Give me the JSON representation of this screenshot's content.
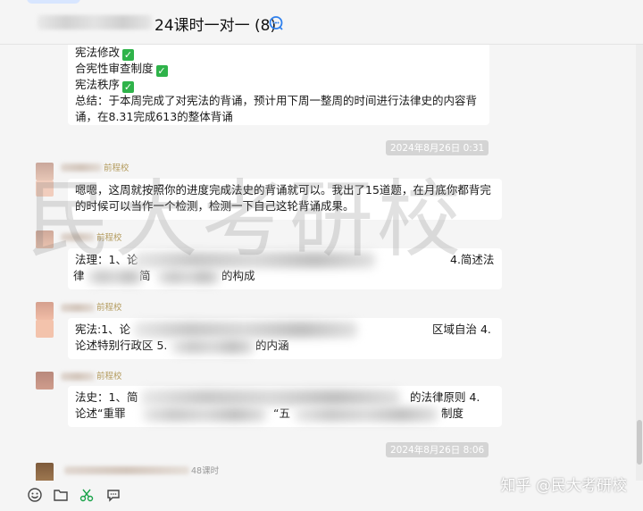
{
  "header": {
    "title": "24课时一对一 (8)",
    "icon": "chat-bubble-icon"
  },
  "messages": {
    "m1": {
      "lines": [
        "宪法修改",
        "合宪性审查制度",
        "宪法秩序"
      ],
      "summary_1": "总结：于本周完成了对宪法的背诵，预计用下周一整周的时间进行法律史的内容背",
      "summary_2": "诵，在8.31完成613的整体背诵"
    },
    "ts1": "2024年8月26日 0:31",
    "m2": {
      "sender": "前程校",
      "line_1": "嗯嗯，这周就按照你的进度完成法史的背诵就可以。我出了15道题，在月底你都背完",
      "line_2": "的时候可以当作一个检测，检测一下自己这轮背诵成果。"
    },
    "m3": {
      "sender": "前程校",
      "line_1a": "法理：1、论",
      "line_1b": "4.简述法",
      "line_2a": "律",
      "line_2b": "简",
      "line_2c": "的构成"
    },
    "m4": {
      "sender": "前程校",
      "line_1a": "宪法:1、论",
      "line_1b": "区域自治 4.",
      "line_2a": "论述特别行政区 5.",
      "line_2b": "的内涵"
    },
    "m5": {
      "sender": "前程校",
      "line_1a": "法史：1、简",
      "line_1b": "的法律原则 4.",
      "line_2a": "论述“重罪",
      "line_2b": "“五",
      "line_2c": "制度"
    },
    "ts2": "2024年8月26日 8:06",
    "m6": {
      "sender": "48课时"
    }
  },
  "watermark": "民大考研校",
  "zhihu_mark": "知乎 @民大考研校",
  "toolbar": [
    "emoji-icon",
    "folder-icon",
    "scissors-icon",
    "chat-icon"
  ],
  "colors": {
    "check_green": "#2fb34a",
    "sender_gold": "#b39a5c"
  }
}
